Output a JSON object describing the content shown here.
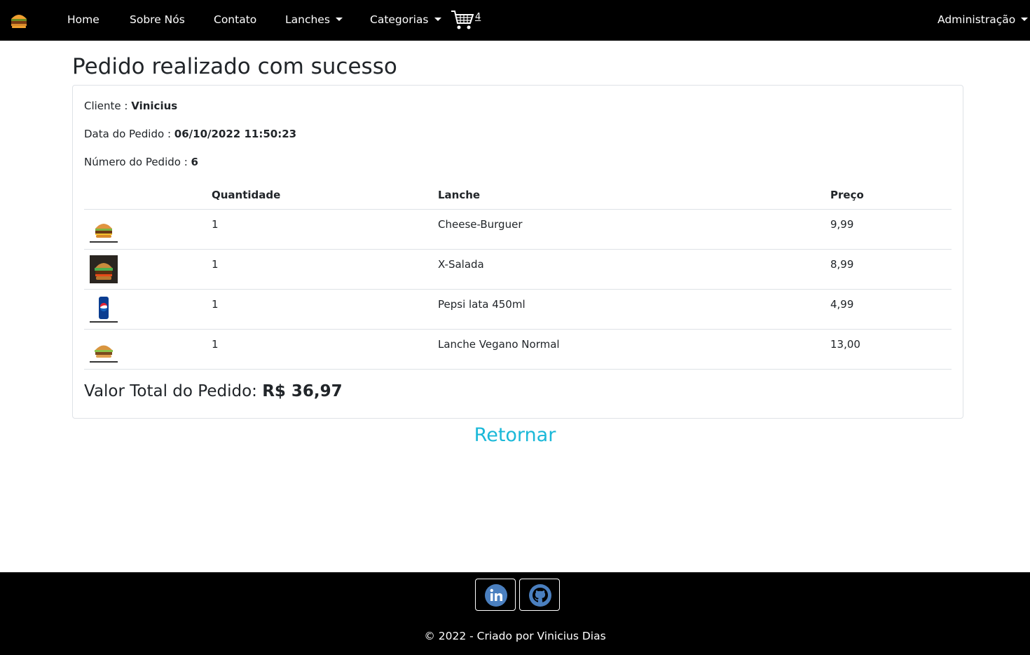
{
  "nav": {
    "home": "Home",
    "about": "Sobre Nós",
    "contact": "Contato",
    "lanches": "Lanches",
    "categorias": "Categorias",
    "cart_count": "4",
    "admin": "Administração"
  },
  "page": {
    "title": "Pedido realizado com sucesso"
  },
  "order": {
    "client_label": "Cliente : ",
    "client_value": "Vinicius",
    "date_label": "Data do Pedido : ",
    "date_value": "06/10/2022 11:50:23",
    "number_label": "Número do Pedido : ",
    "number_value": "6",
    "total_label": "Valor Total do Pedido: ",
    "total_value": "R$ 36,97"
  },
  "table": {
    "headers": [
      "Quantidade",
      "Lanche",
      "Preço"
    ],
    "rows": [
      {
        "qty": "1",
        "name": "Cheese-Burguer",
        "price": "9,99",
        "icon": "burger-icon"
      },
      {
        "qty": "1",
        "name": "X-Salada",
        "price": "8,99",
        "icon": "x-salada-photo"
      },
      {
        "qty": "1",
        "name": "Pepsi lata 450ml",
        "price": "4,99",
        "icon": "pepsi-can-icon"
      },
      {
        "qty": "1",
        "name": "Lanche Vegano Normal",
        "price": "13,00",
        "icon": "vegan-burger-icon"
      }
    ]
  },
  "actions": {
    "return": "Retornar"
  },
  "footer": {
    "copyright": "© 2022 - Criado por Vinicius Dias",
    "linkedin_icon": "linkedin-icon",
    "github_icon": "github-icon"
  },
  "colors": {
    "navbar_bg": "#000000",
    "accent_link": "#1ab8d8",
    "text": "#212529",
    "border": "#dee2e6"
  }
}
